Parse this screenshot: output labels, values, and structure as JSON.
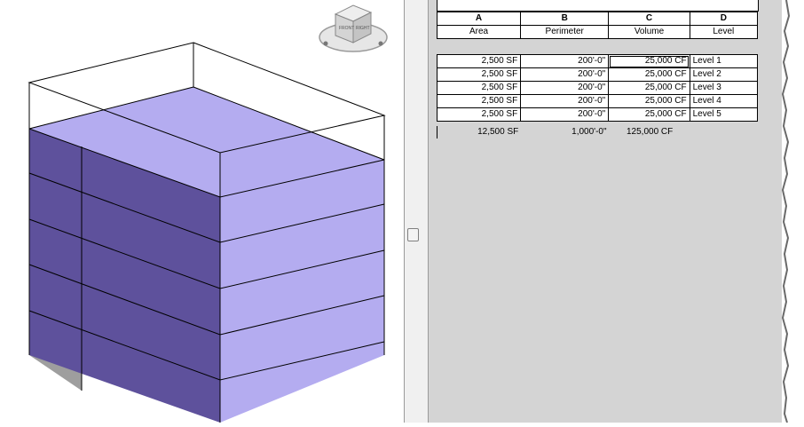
{
  "viewcube": {
    "face_front": "FRONT",
    "face_right": "RIGHT"
  },
  "schedule": {
    "letters": [
      "A",
      "B",
      "C",
      "D"
    ],
    "columns": [
      "Area",
      "Perimeter",
      "Volume",
      "Level"
    ],
    "rows": [
      {
        "area": "2,500 SF",
        "perimeter": "200'-0\"",
        "volume": "25,000 CF",
        "level": "Level 1"
      },
      {
        "area": "2,500 SF",
        "perimeter": "200'-0\"",
        "volume": "25,000 CF",
        "level": "Level 2"
      },
      {
        "area": "2,500 SF",
        "perimeter": "200'-0\"",
        "volume": "25,000 CF",
        "level": "Level 3"
      },
      {
        "area": "2,500 SF",
        "perimeter": "200'-0\"",
        "volume": "25,000 CF",
        "level": "Level 4"
      },
      {
        "area": "2,500 SF",
        "perimeter": "200'-0\"",
        "volume": "25,000 CF",
        "level": "Level 5"
      }
    ],
    "totals": {
      "area": "12,500 SF",
      "perimeter": "1,000'-0\"",
      "volume": "125,000 CF"
    }
  },
  "colors": {
    "mass_top": "#b4acf0",
    "mass_side": "#5e519c",
    "wall_grey": "#9e9e9e",
    "schedule_bg": "#d4d4d4"
  }
}
